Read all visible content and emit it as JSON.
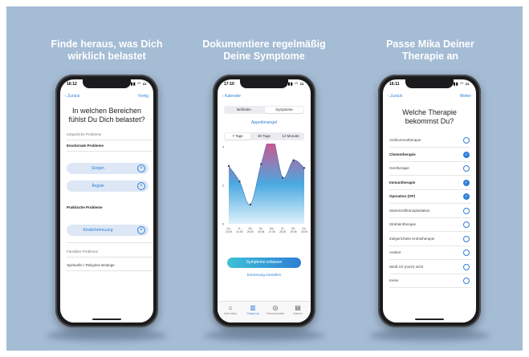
{
  "headlines": [
    {
      "line1": "Finde heraus, was Dich",
      "line2": "wirklich belastet"
    },
    {
      "line1": "Dokumentiere regelmäßig",
      "line2": "Deine Symptome"
    },
    {
      "line1": "Passe Mika Deiner",
      "line2": "Therapie an"
    }
  ],
  "phone1": {
    "time": "16:12",
    "back": "Zurück",
    "done": "Fertig",
    "question": "In welchen Bereichen fühlst Du Dich belastet?",
    "sections": {
      "koerper": "Körperliche Probleme",
      "emotional": "Emotionale Probleme",
      "praktisch": "Praktische Probleme",
      "familiaer": "Familiäre Probleme",
      "spirit": "Spirituelle / Religiöse Belange"
    },
    "pills": [
      "Sorgen",
      "Ängste",
      "Kinderbetreuung"
    ],
    "remove_glyph": "×"
  },
  "phone2": {
    "time": "17:10",
    "back": "Kalender",
    "segments": [
      "Befinden",
      "Symptome"
    ],
    "selected_segment": "Symptome",
    "symptom": "Appetitmangel",
    "ranges": [
      "7 Tage",
      "30 Tage",
      "12 Monate"
    ],
    "selected_range": "7 Tage",
    "cta": "Symptome erfassen",
    "edit_link": "Erinnerung einstellen",
    "tabs": [
      {
        "label": "Mein Mika",
        "icon": "home-icon",
        "glyph": "⌂"
      },
      {
        "label": "Check-Up",
        "icon": "bar-chart-icon",
        "glyph": "▥"
      },
      {
        "label": "Themenwelten",
        "icon": "compass-icon",
        "glyph": "◎"
      },
      {
        "label": "Notizen",
        "icon": "document-icon",
        "glyph": "▤"
      }
    ],
    "active_tab": "Check-Up"
  },
  "chart_data": {
    "type": "area",
    "x": [
      "Do. 23.06",
      "Fr. 24.06",
      "Sa. 25.06",
      "So. 26.06",
      "Mo. 27.06",
      "Di. 28.06",
      "Mi. 29.06",
      "Do. 30.06"
    ],
    "values": [
      3.0,
      2.2,
      1.0,
      3.1,
      4.6,
      2.4,
      3.3,
      2.9
    ],
    "ylim": [
      0,
      4
    ],
    "yticks": [
      0,
      2,
      4
    ],
    "colors": {
      "high": "#e8457f",
      "low": "#3ec1d8"
    }
  },
  "phone3": {
    "time": "16:11",
    "back": "Zurück",
    "next": "Weiter",
    "question": "Welche Therapie bekommst Du?",
    "options": [
      {
        "label": "Antihormontherapie",
        "checked": false
      },
      {
        "label": "Chemotherapie",
        "checked": true
      },
      {
        "label": "Gentherapie",
        "checked": false
      },
      {
        "label": "Immuntherapie",
        "checked": true
      },
      {
        "label": "Operation (OP)",
        "checked": true
      },
      {
        "label": "Stammzelltransplantation",
        "checked": false
      },
      {
        "label": "Strahlentherapie",
        "checked": false
      },
      {
        "label": "Zielgerichtete Krebstherapie",
        "checked": false
      },
      {
        "label": "Andere",
        "checked": false
      },
      {
        "label": "Weiß ich (noch) nicht",
        "checked": false
      },
      {
        "label": "Keine",
        "checked": false
      }
    ]
  }
}
